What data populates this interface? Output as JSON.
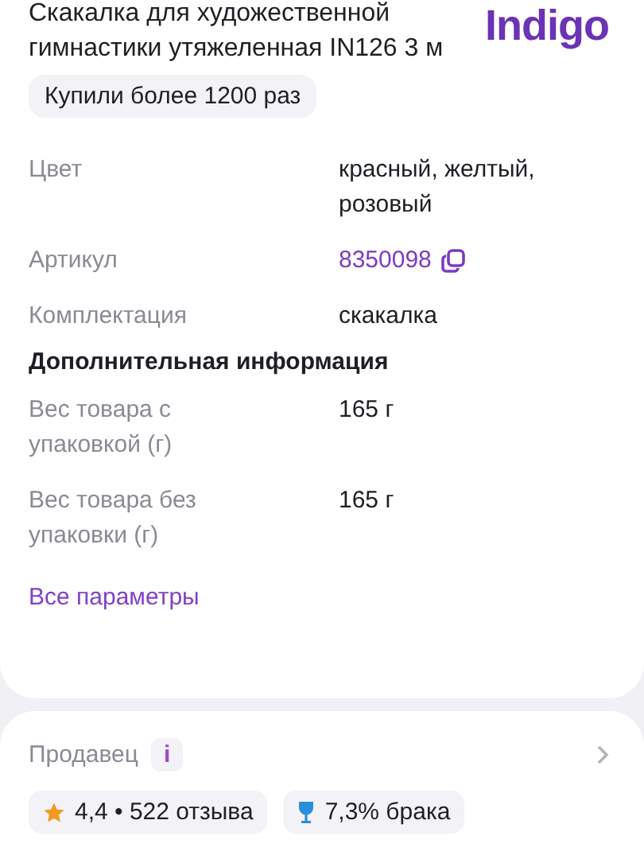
{
  "product": {
    "title": "Скакалка для художественной гимнастики утяжеленная IN126 3 м",
    "brand": "Indigo",
    "purchases_badge": "Купили более 1200 раз"
  },
  "params": [
    {
      "kind": "row",
      "label": "Цвет",
      "value": "красный, желтый, розовый"
    },
    {
      "kind": "copy",
      "label": "Артикул",
      "value": "8350098"
    },
    {
      "kind": "row",
      "label": "Комплектация",
      "value": "скакалка"
    },
    {
      "kind": "heading",
      "label": "Дополнительная информация"
    },
    {
      "kind": "row",
      "label": "Вес товара с упаковкой (г)",
      "value": "165 г"
    },
    {
      "kind": "row",
      "label": "Вес товара без упаковки (г)",
      "value": "165 г"
    }
  ],
  "all_params_link": "Все параметры",
  "seller": {
    "label": "Продавец",
    "info": "i",
    "chips": [
      {
        "kind": "rating",
        "text": "4,4 • 522 отзыва"
      },
      {
        "kind": "defects",
        "text": "7,3% брака"
      }
    ]
  }
}
